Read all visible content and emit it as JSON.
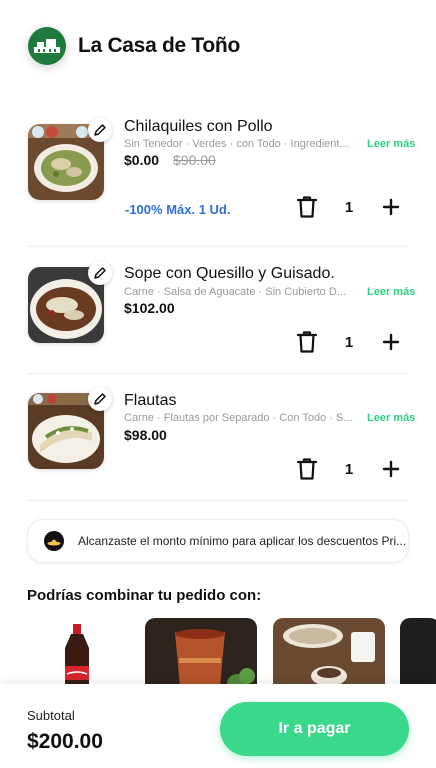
{
  "store": {
    "name": "La Casa de Toño"
  },
  "cart": {
    "items": [
      {
        "name": "Chilaquiles con Pollo",
        "description": "Sin Tenedor · Verdes · con Todo · Ingredient...",
        "read_more": "Leer más",
        "price": "$0.00",
        "old_price": "$90.00",
        "promo": "-100% Máx. 1 Ud.",
        "quantity": "1"
      },
      {
        "name": "Sope con Quesillo y Guisado.",
        "description": "Carne · Salsa de Aguacate · Sin Cubierto D...",
        "read_more": "Leer más",
        "price": "$102.00",
        "quantity": "1"
      },
      {
        "name": "Flautas",
        "description": "Carne · Flautas por Separado · Con Todo · S...",
        "read_more": "Leer más",
        "price": "$98.00",
        "quantity": "1"
      }
    ]
  },
  "notice": {
    "text": "Alcanzaste el monto mínimo para aplicar los descuentos Pri..."
  },
  "suggestions": {
    "title": "Podrías combinar tu pedido con:",
    "items": [
      "coca-cola-bottle",
      "clay-cup-drink",
      "rice-pudding-dessert",
      "dark-item"
    ]
  },
  "footer": {
    "subtotal_label": "Subtotal",
    "subtotal_value": "$200.00",
    "pay_button": "Ir a pagar"
  },
  "colors": {
    "accent": "#3ad88a",
    "promo": "#2f6fd6",
    "read_more": "#2ecf7f",
    "logo": "#1f7a3e"
  }
}
